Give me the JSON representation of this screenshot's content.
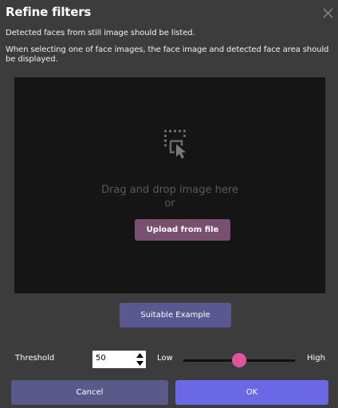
{
  "dialog": {
    "title": "Refine filters",
    "description_1": "Detected faces from still image should be listed.",
    "description_2": "When selecting one of face images, the face image and detected face area should be displayed.",
    "close_icon": "close-icon"
  },
  "dropzone": {
    "icon": "drag-drop-select-icon",
    "line1": "Drag and drop image here",
    "line2": "or",
    "upload_label": "Upload from file"
  },
  "example_label": "Suitable Example",
  "threshold": {
    "label": "Threshold",
    "value": "50",
    "low_label": "Low",
    "high_label": "High",
    "slider_level": 0.5
  },
  "footer": {
    "cancel_label": "Cancel",
    "ok_label": "OK"
  },
  "colors": {
    "background": "#3c3c3c",
    "dropzone": "#151515",
    "upload_button": "#7a5070",
    "example_button": "#5a5890",
    "cancel_button": "#5a5a8a",
    "ok_button": "#6b68e6",
    "slider_thumb": "#e0559a"
  }
}
